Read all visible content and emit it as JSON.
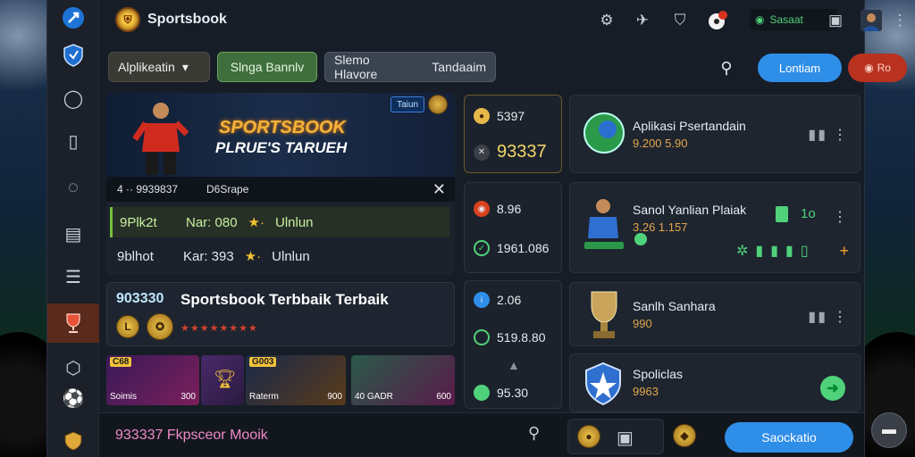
{
  "app": {
    "title": "Sportsbook"
  },
  "topbar": {
    "status_text": "Sasaat",
    "icons": [
      "settings-icon",
      "pin-icon",
      "shield-icon",
      "ball-notification-icon",
      "status-icon",
      "wallet-icon",
      "avatar",
      "more-icon"
    ]
  },
  "sidebar": {
    "icons": [
      "compass-icon",
      "shield-icon",
      "chat-icon",
      "book-icon",
      "comment-icon",
      "layout-icon",
      "menu-icon",
      "trophy-icon",
      "settings-icon",
      "soccer-ball-icon",
      "cup-icon"
    ]
  },
  "filters": {
    "dropdown_label": "Alplikeatin",
    "green_label": "Slnga Bannlv",
    "third_left": "Slemo Hlavore",
    "third_right": "Tandaaim"
  },
  "actions": {
    "blue_label": "Lontiam",
    "red_label": "Ro"
  },
  "hero": {
    "title": "SPORTSBOOK",
    "subtitle": "PLRUE'S TARUEH",
    "badge": "Taiun",
    "bar_left": "4 ·· 9939837",
    "bar_mid": "D6Srape"
  },
  "list": [
    {
      "left": "9Plk2t",
      "right": "Nar: 080",
      "suffix": "Ulnlun"
    },
    {
      "left": "9blhot",
      "right": "Kar: 393",
      "suffix": "Ulnlun"
    }
  ],
  "featured": {
    "number": "903330",
    "title": "Sportsbook Terbbaik Terbaik",
    "coin_label": "L"
  },
  "tiles": [
    {
      "tag": "C68",
      "team": "Soimis",
      "score": "300"
    },
    {
      "tag": "G003",
      "team": "Raterm",
      "score": "900"
    },
    {
      "tag": "",
      "team": "40 GADR",
      "score": "600"
    }
  ],
  "middle": {
    "box1": {
      "top": "5397",
      "big": "93337"
    },
    "box2": {
      "top": "8.96",
      "bottom": "1961.086"
    },
    "box3": {
      "top": "2.06",
      "mid": "519.8.80",
      "bottom": "95.30"
    }
  },
  "right_cards": [
    {
      "title": "Aplikasi Psertandain",
      "sub": "9.200 5.90"
    },
    {
      "title": "Sanol Yanlian Plaiak",
      "sub": "3.26 1.157",
      "badge": "1o"
    },
    {
      "title": "Sanlh Sanhara",
      "sub": "990"
    },
    {
      "title": "Spoliclas",
      "sub": "9963"
    }
  ],
  "bottom_bar": {
    "text": "933337 Fkpsceor Mooik",
    "cta": "Saockatio"
  },
  "colors": {
    "accent_blue": "#2f8ee8",
    "accent_green": "#4fd27a",
    "accent_red": "#b8321f",
    "gold": "#f3c23a"
  }
}
